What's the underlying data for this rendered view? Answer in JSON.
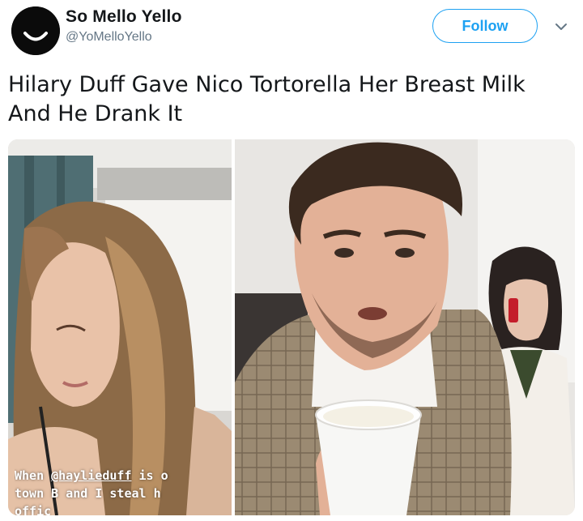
{
  "header": {
    "display_name": "So Mello Yello",
    "handle": "@YoMelloYello",
    "follow_label": "Follow"
  },
  "tweet": {
    "text": "Hilary Duff Gave Nico Tortorella Her Breast Milk And He Drank It"
  },
  "media": {
    "caption": {
      "line1_prefix": "When ",
      "mention": "@haylieduff",
      "line1_suffix": " is o",
      "line2": "town B and I steal h",
      "line3": "offic"
    }
  },
  "colors": {
    "accent": "#1da1f2",
    "secondary_text": "#657786",
    "primary_text": "#14171a"
  },
  "icons": {
    "avatar": "smiley-avatar-icon",
    "caret": "chevron-down-icon"
  }
}
